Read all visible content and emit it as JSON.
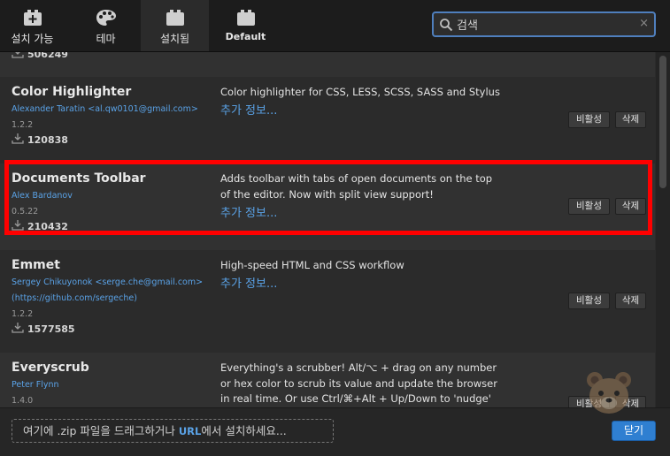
{
  "tabs": [
    {
      "label": "설치 가능",
      "icon": "extension-add-icon"
    },
    {
      "label": "테마",
      "icon": "palette-icon"
    },
    {
      "label": "설치됨",
      "icon": "extension-installed-icon"
    },
    {
      "label": "Default",
      "icon": "extension-default-icon"
    }
  ],
  "search": {
    "value": "검색",
    "clear": "×"
  },
  "top_row": {
    "downloads": "506249"
  },
  "extensions": [
    {
      "name": "Color Highlighter",
      "author": "Alexander Taratin <al.qw0101@gmail.com>",
      "version": "1.2.2",
      "downloads": "120838",
      "description": "Color highlighter for CSS, LESS, SCSS, SASS and Stylus",
      "more": "추가 정보...",
      "disable": "비활성",
      "remove": "삭제"
    },
    {
      "name": "Documents Toolbar",
      "author": "Alex Bardanov",
      "version": "0.5.22",
      "downloads": "210432",
      "description": "Adds toolbar with tabs of open documents on the top of the editor. Now with split view support!",
      "more": "추가 정보...",
      "disable": "비활성",
      "remove": "삭제"
    },
    {
      "name": "Emmet",
      "author": "Sergey Chikuyonok <serge.che@gmail.com>",
      "author_url": "(https://github.com/sergeche)",
      "version": "1.2.2",
      "downloads": "1577585",
      "description": "High-speed HTML and CSS workflow",
      "more": "추가 정보...",
      "disable": "비활성",
      "remove": "삭제"
    },
    {
      "name": "Everyscrub",
      "author": "Peter Flynn",
      "version": "1.4.0",
      "description": "Everything's a scrubber! Alt/⌥ + drag on any number or hex color to scrub its value and update the browser in real time. Or use Ctrl/⌘+Alt + Up/Down to 'nudge' values with",
      "disable": "비활성",
      "remove": "삭제"
    }
  ],
  "footer": {
    "drop_prefix": "여기에 .zip 파일을 드래그하거나 ",
    "drop_url": "URL",
    "drop_suffix": "에서 설치하세요...",
    "close": "닫기"
  },
  "colors": {
    "accent": "#5aa2e6",
    "highlight_border": "#ff0000",
    "primary_button": "#2f7fd1"
  }
}
